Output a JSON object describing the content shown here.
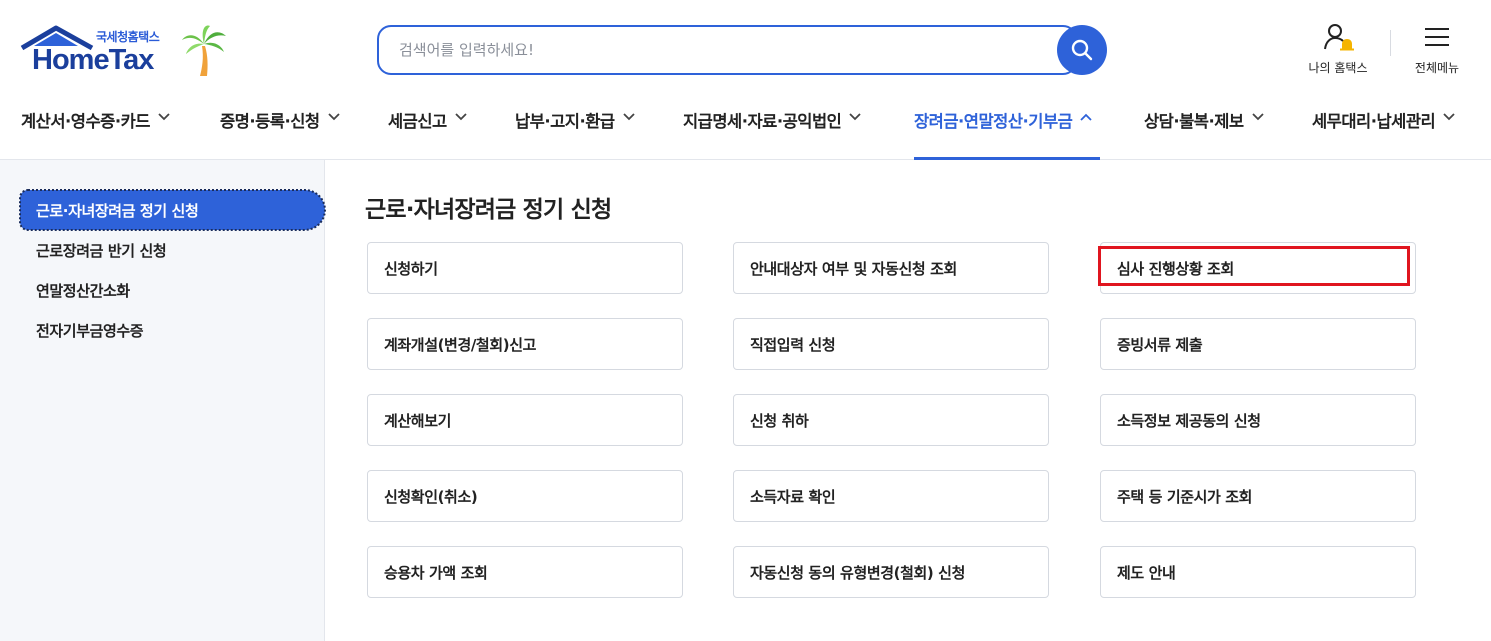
{
  "header": {
    "logo_sub": "국세청홈택스",
    "logo_main": "HomeTax",
    "search_placeholder": "검색어를 입력하세요!",
    "util": [
      {
        "label": "나의 홈택스",
        "icon": "user-bell-icon"
      },
      {
        "label": "전체메뉴",
        "icon": "hamburger-icon"
      }
    ]
  },
  "gnb": {
    "items": [
      {
        "label": "계산서·영수증·카드",
        "expanded": false
      },
      {
        "label": "증명·등록·신청",
        "expanded": false
      },
      {
        "label": "세금신고",
        "expanded": false
      },
      {
        "label": "납부·고지·환급",
        "expanded": false
      },
      {
        "label": "지급명세·자료·공익법인",
        "expanded": false
      },
      {
        "label": "장려금·연말정산·기부금",
        "expanded": true
      },
      {
        "label": "상담·불복·제보",
        "expanded": false
      },
      {
        "label": "세무대리·납세관리",
        "expanded": false
      }
    ]
  },
  "sidebar": {
    "items": [
      {
        "label": "근로·자녀장려금 정기 신청",
        "active": true
      },
      {
        "label": "근로장려금 반기 신청",
        "active": false
      },
      {
        "label": "연말정산간소화",
        "active": false
      },
      {
        "label": "전자기부금영수증",
        "active": false
      }
    ]
  },
  "main": {
    "title": "근로·자녀장려금 정기 신청",
    "tiles": [
      [
        "신청하기",
        "안내대상자 여부 및 자동신청 조회",
        "심사 진행상황 조회"
      ],
      [
        "계좌개설(변경/철회)신고",
        "직접입력 신청",
        "증빙서류 제출"
      ],
      [
        "계산해보기",
        "신청 취하",
        "소득정보 제공동의 신청"
      ],
      [
        "신청확인(취소)",
        "소득자료 확인",
        "주택 등 기준시가 조회"
      ],
      [
        "승용차 가액 조회",
        "자동신청 동의 유형변경(철회) 신청",
        "제도 안내"
      ]
    ],
    "highlighted_tile": "심사 진행상황 조회"
  },
  "colors": {
    "accent": "#2e62d9",
    "highlight": "#e0151f",
    "sidebar_bg": "#f5f7fa"
  }
}
